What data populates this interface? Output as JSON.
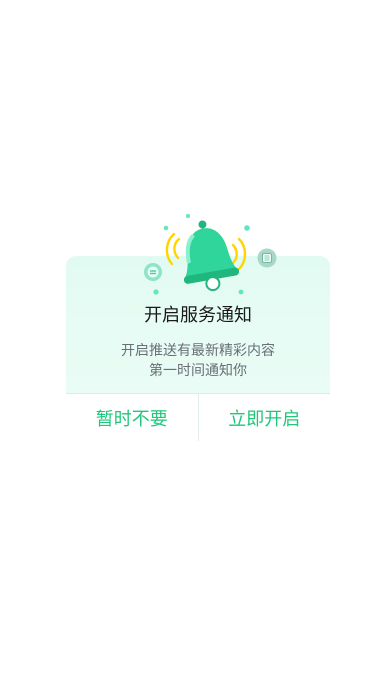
{
  "dialog": {
    "title": "开启服务通知",
    "description_line1": "开启推送有最新精彩内容",
    "description_line2": "第一时间通知你",
    "cancel_label": "暂时不要",
    "confirm_label": "立即开启"
  },
  "illustration": {
    "icon": "bell-icon",
    "badge_left_glyph": "…",
    "badge_right_glyph": "日"
  },
  "colors": {
    "accent": "#20c77a",
    "bell": "#2fd59b",
    "ring": "#ffd500",
    "dialog_bg": "#e2fbf2"
  }
}
